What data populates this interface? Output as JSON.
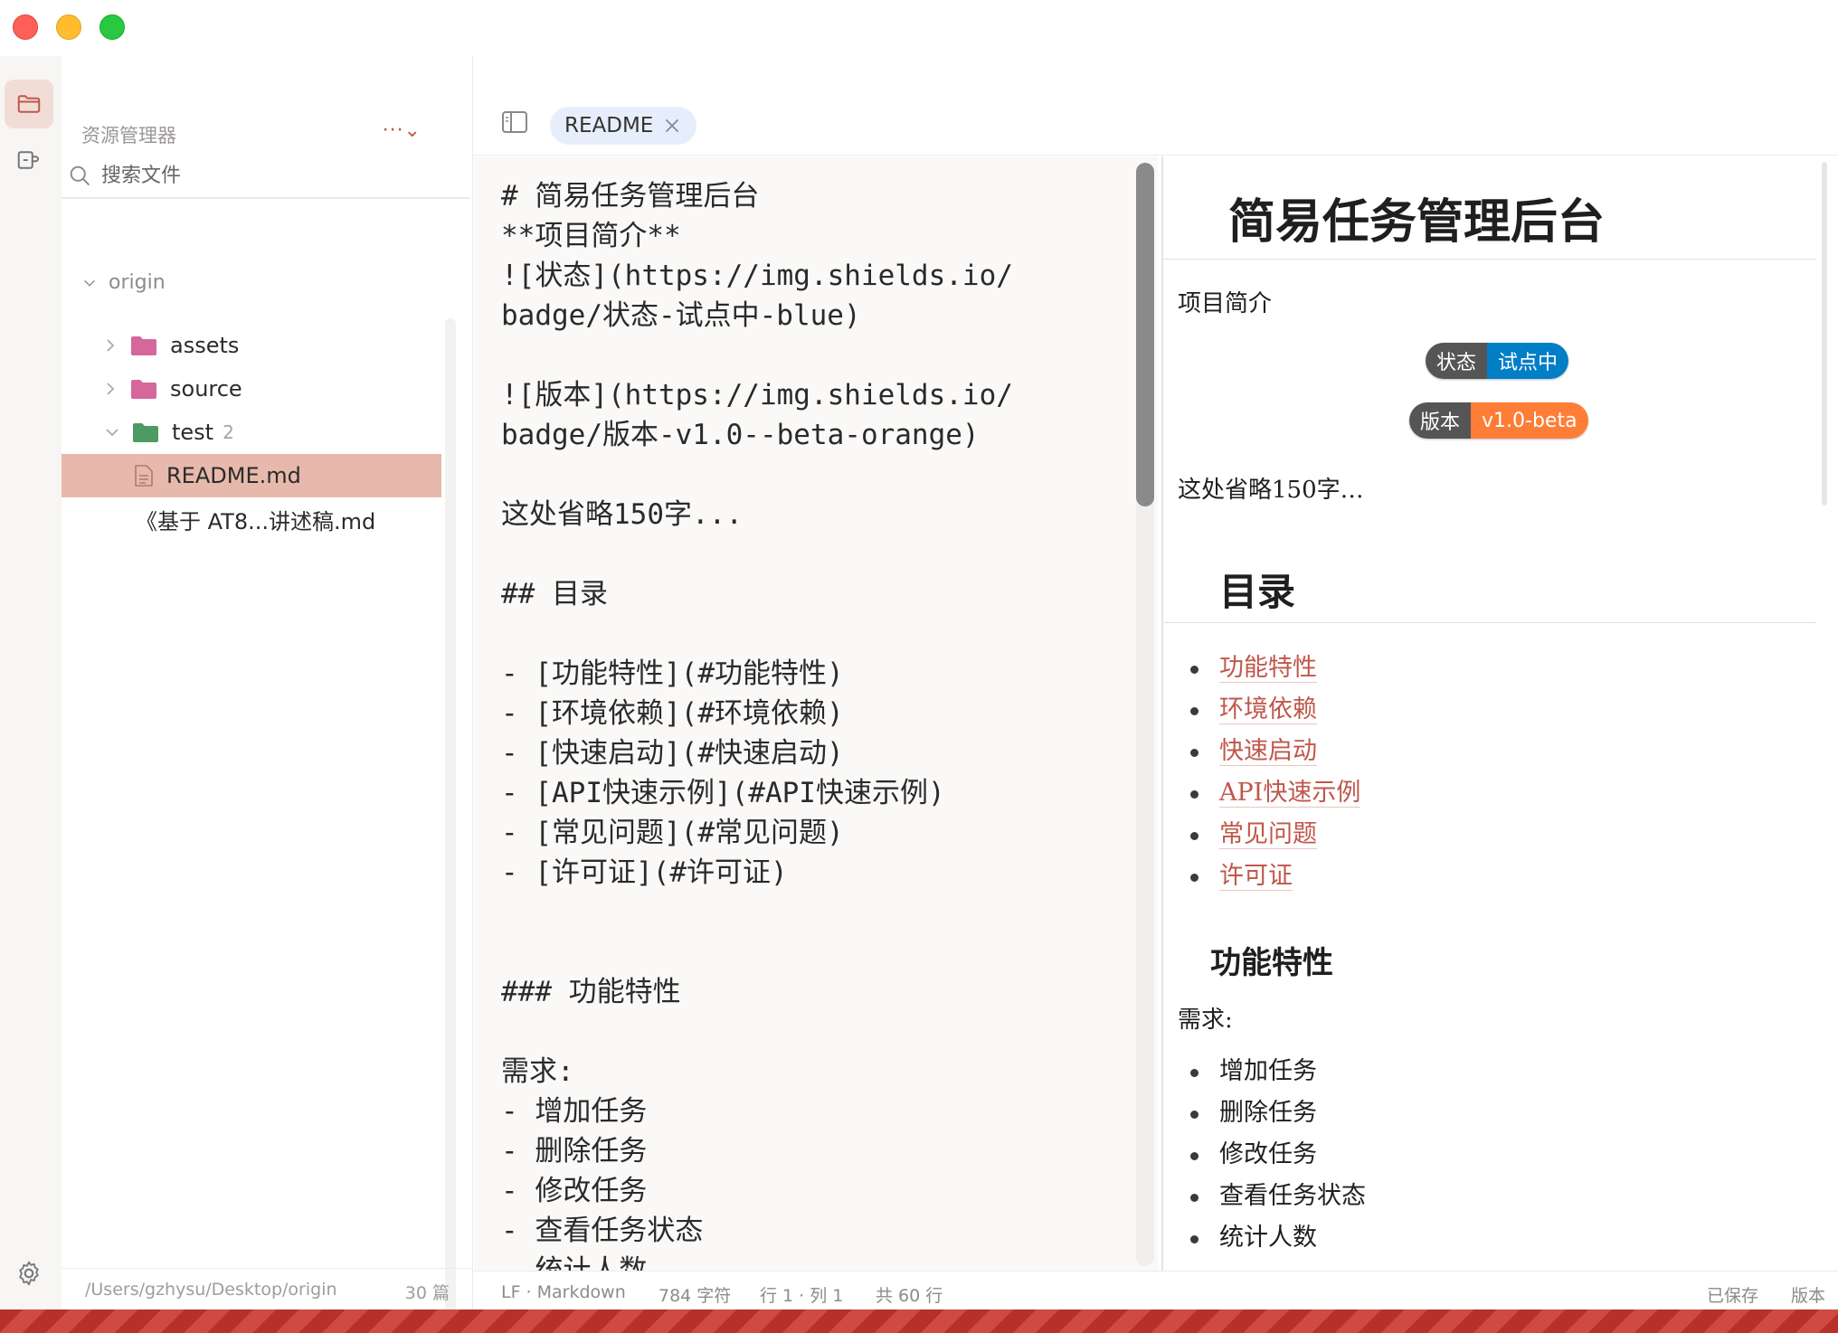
{
  "window": {
    "controls": [
      "close",
      "minimize",
      "maximize"
    ]
  },
  "activity_bar": {
    "items": [
      {
        "icon": "folder-icon",
        "active": true
      },
      {
        "icon": "plugin-icon",
        "active": false
      }
    ],
    "settings_icon": "gear-icon"
  },
  "sidebar": {
    "header": "资源管理器",
    "more": "···⌄",
    "search_placeholder": "搜索文件",
    "root": "origin",
    "tree": [
      {
        "label": "assets",
        "type": "folder",
        "color": "#d5679a",
        "expanded": false
      },
      {
        "label": "source",
        "type": "folder",
        "color": "#d5679a",
        "expanded": false
      },
      {
        "label": "test",
        "type": "folder",
        "color": "#4e9a64",
        "expanded": true,
        "count": "2"
      },
      {
        "label": "README.md",
        "type": "file",
        "selected": true
      },
      {
        "label": "《基于 AT8...讲述稿.md",
        "type": "file",
        "selected": false
      }
    ],
    "footer_path": "/Users/gzhysu/Desktop/origin",
    "footer_count": "30 篇"
  },
  "tabs": [
    {
      "label": "README",
      "active": true
    }
  ],
  "editor": {
    "lines": [
      "# 简易任务管理后台",
      "**项目简介**",
      "![状态](https://img.shields.io/",
      "badge/状态-试点中-blue)",
      "",
      "![版本](https://img.shields.io/",
      "badge/版本-v1.0--beta-orange)",
      "",
      "这处省略150字...",
      "",
      "## 目录",
      "",
      "- [功能特性](#功能特性)",
      "- [环境依赖](#环境依赖)",
      "- [快速启动](#快速启动)",
      "- [API快速示例](#API快速示例)",
      "- [常见问题](#常见问题)",
      "- [许可证](#许可证)",
      "",
      "",
      "### 功能特性",
      "",
      "需求:",
      "- 增加任务",
      "- 删除任务",
      "- 修改任务",
      "- 查看任务状态",
      "- 统计人数"
    ]
  },
  "preview": {
    "h1": "简易任务管理后台",
    "intro": "项目简介",
    "badges": [
      {
        "label": "状态",
        "value": "试点中",
        "color": "#007ec6"
      },
      {
        "label": "版本",
        "value": "v1.0-beta",
        "color": "#fe7d37"
      }
    ],
    "omitted": "这处省略150字…",
    "toc_title": "目录",
    "toc": [
      "功能特性",
      "环境依赖",
      "快速启动",
      "API快速示例",
      "常见问题",
      "许可证"
    ],
    "features_title": "功能特性",
    "requirements_label": "需求:",
    "requirements": [
      "增加任务",
      "删除任务",
      "修改任务",
      "查看任务状态",
      "统计人数"
    ]
  },
  "statusbar": {
    "encoding": "LF · Markdown",
    "chars": "784 字符",
    "position": "行 1 · 列 1",
    "total_lines": "共 60 行",
    "saved": "已保存",
    "version": "版本"
  }
}
